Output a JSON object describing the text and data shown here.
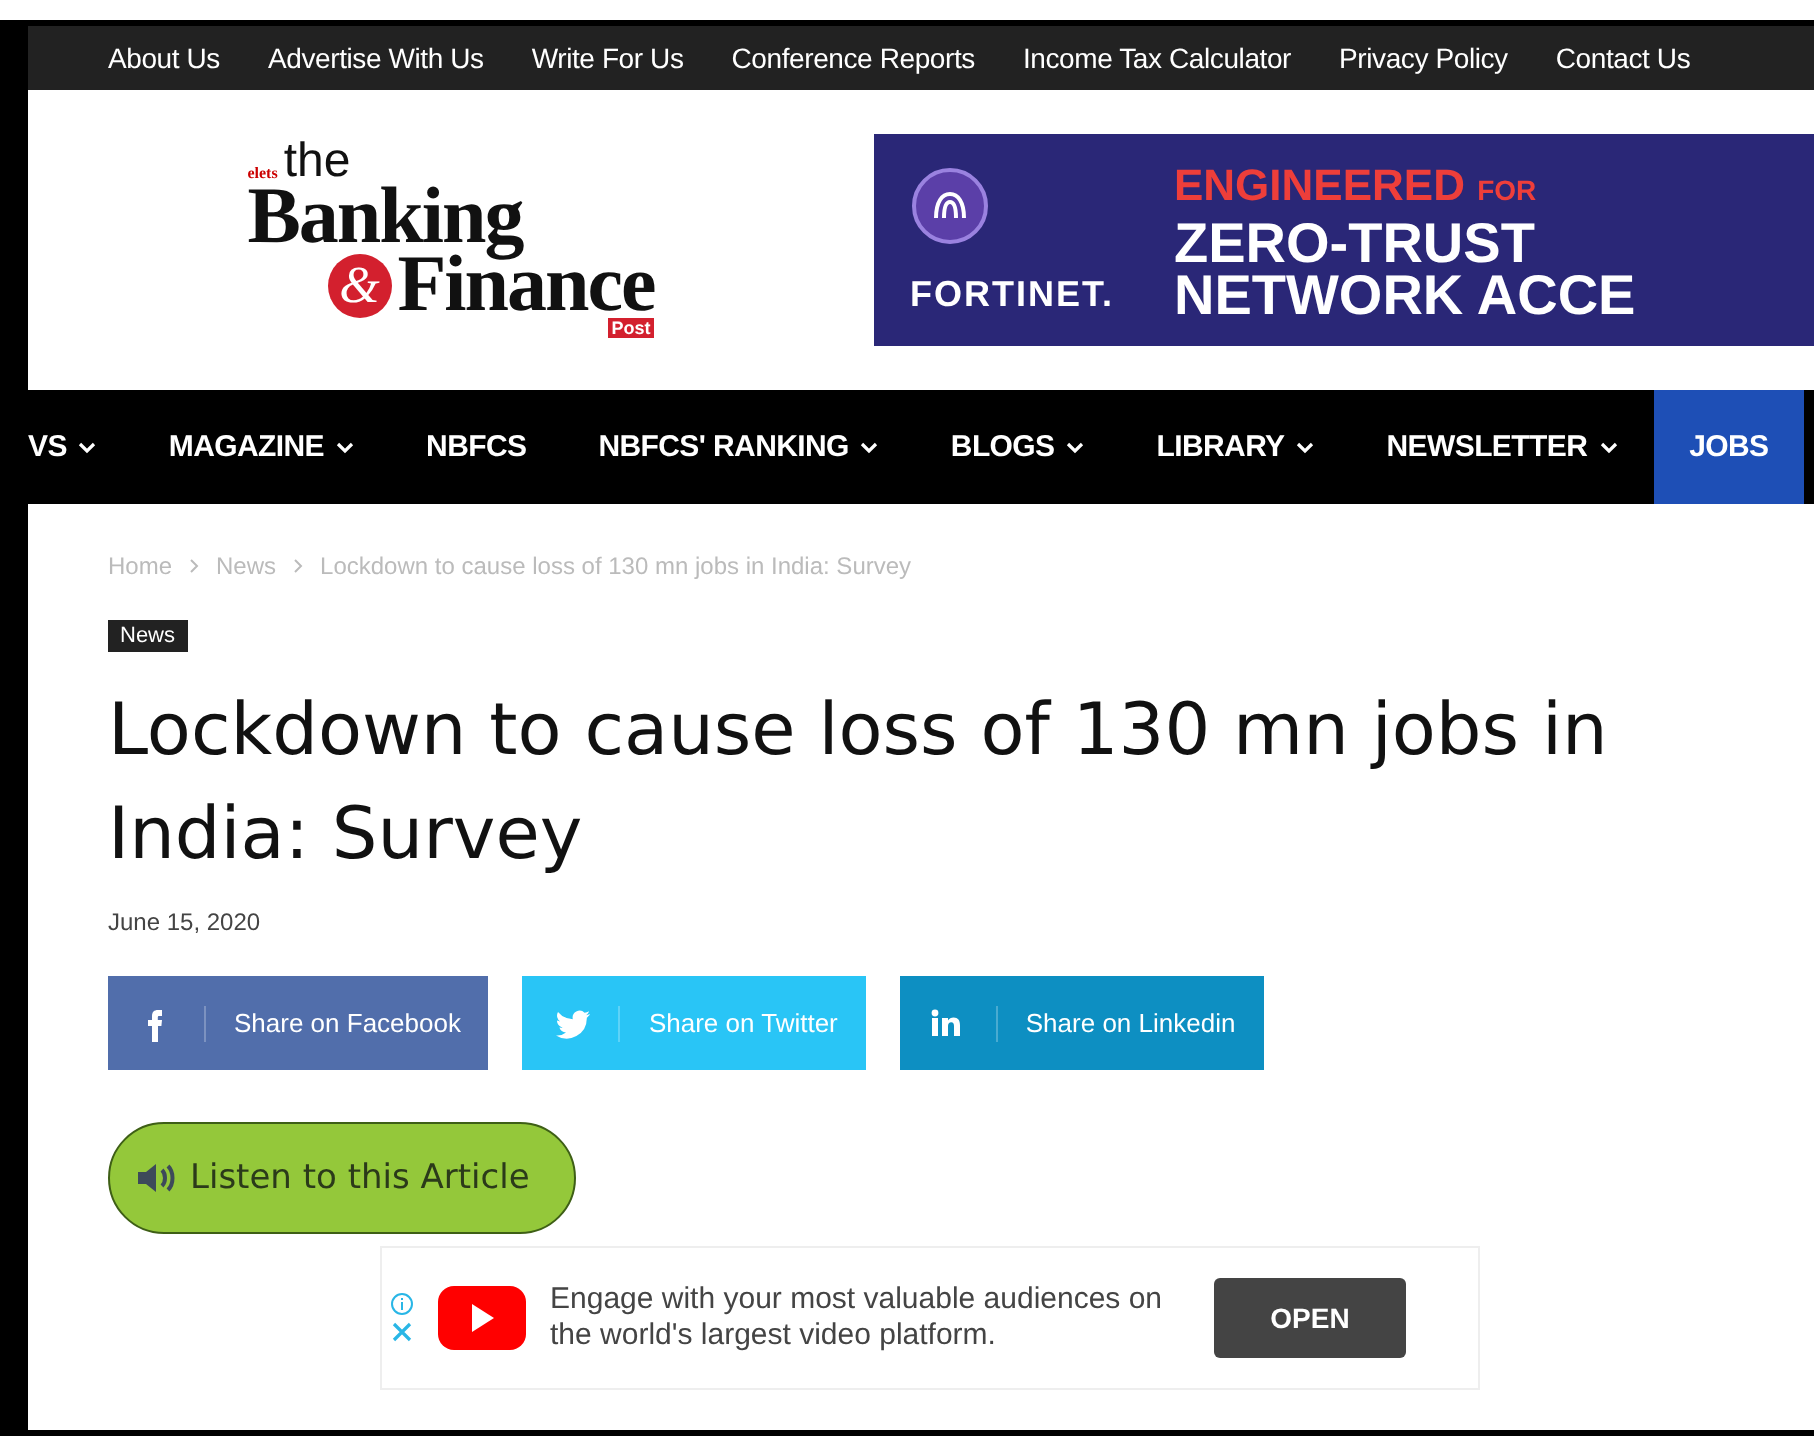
{
  "top_links": [
    "About Us",
    "Advertise With Us",
    "Write For Us",
    "Conference Reports",
    "Income Tax Calculator",
    "Privacy Policy",
    "Contact Us"
  ],
  "logo": {
    "publisher": "elets",
    "article": "the",
    "line1": "Banking",
    "ampersand": "&",
    "line2": "Finance",
    "tag": "Post"
  },
  "banner": {
    "brand": "FORTINET.",
    "line1": "ENGINEERED",
    "line1_small": "FOR",
    "line2": "ZERO-TRUST",
    "line3": "NETWORK ACCE"
  },
  "nav": [
    {
      "label": "VS",
      "dropdown": true,
      "selected": false
    },
    {
      "label": "MAGAZINE",
      "dropdown": true,
      "selected": false
    },
    {
      "label": "NBFCS",
      "dropdown": false,
      "selected": false
    },
    {
      "label": "NBFCS' RANKING",
      "dropdown": true,
      "selected": false
    },
    {
      "label": "BLOGS",
      "dropdown": true,
      "selected": false
    },
    {
      "label": "LIBRARY",
      "dropdown": true,
      "selected": false
    },
    {
      "label": "NEWSLETTER",
      "dropdown": true,
      "selected": false
    },
    {
      "label": "JOBS",
      "dropdown": false,
      "selected": true
    }
  ],
  "breadcrumb": [
    "Home",
    "News",
    "Lockdown to cause loss of 130 mn jobs in India: Survey"
  ],
  "category": "News",
  "title": "Lockdown to cause loss of 130 mn jobs in India: Survey",
  "date": "June 15, 2020",
  "share": [
    {
      "kind": "facebook",
      "label": "Share on Facebook",
      "color": "#516eab"
    },
    {
      "kind": "twitter",
      "label": "Share on Twitter",
      "color": "#29c5f6"
    },
    {
      "kind": "linkedin",
      "label": "Share on Linkedin",
      "color": "#0d8fc2"
    }
  ],
  "listen": "Listen to this Article",
  "ad": {
    "text": "Engage with your most valuable audiences on the world's largest video platform.",
    "button": "OPEN"
  }
}
